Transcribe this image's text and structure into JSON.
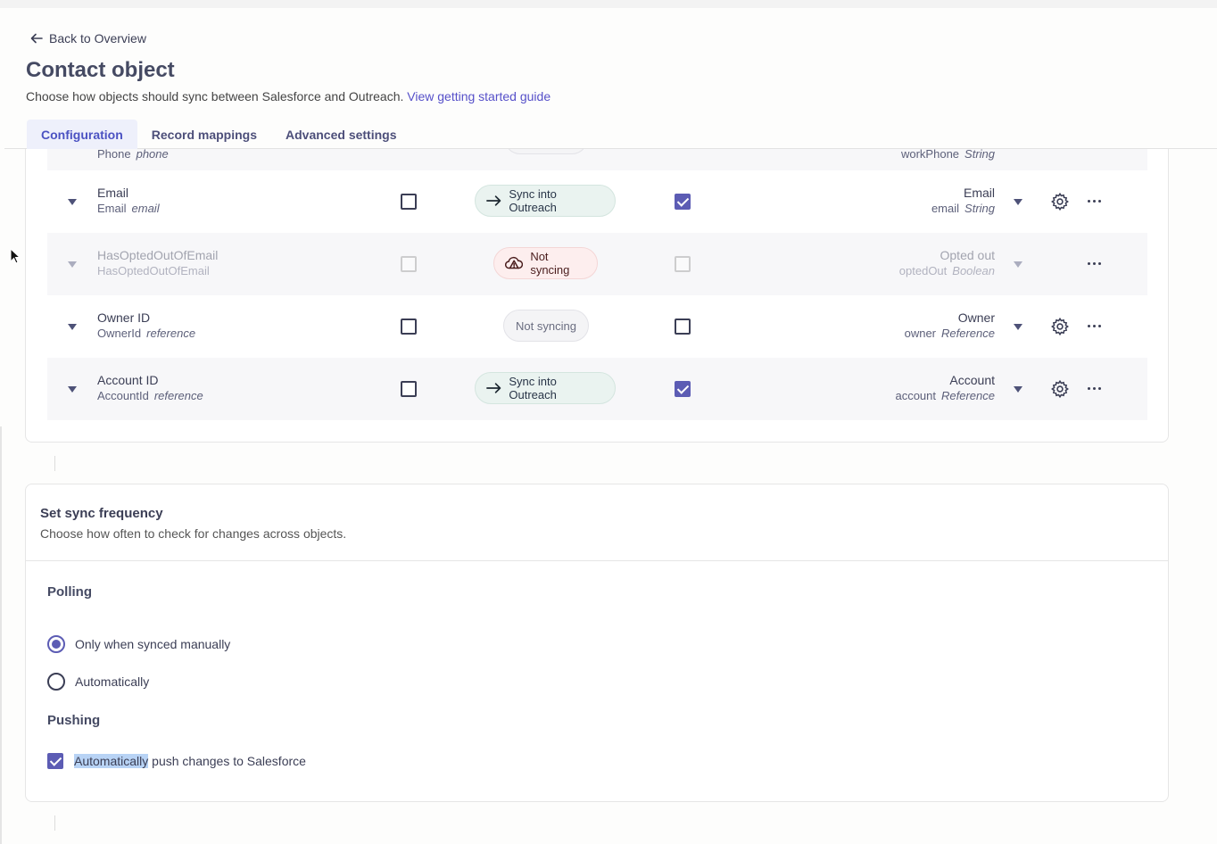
{
  "header": {
    "back_label": "Back to Overview",
    "title": "Contact object",
    "subtitle": "Choose how objects should sync between Salesforce and Outreach.",
    "guide_link": "View getting started guide",
    "tabs": [
      {
        "label": "Configuration",
        "active": true
      },
      {
        "label": "Record mappings",
        "active": false
      },
      {
        "label": "Advanced settings",
        "active": false
      }
    ]
  },
  "partial_row": {
    "name": "Phone",
    "api": "phone",
    "right_api": "workPhone",
    "right_type": "String"
  },
  "mappings": [
    {
      "name": "Email",
      "api_name": "Email",
      "api_type": "email",
      "left_checked": false,
      "sync_label": "Sync into Outreach",
      "sync_state": "sync",
      "right_checked": true,
      "right_name": "Email",
      "right_api": "email",
      "right_type": "String",
      "disabled": false,
      "has_gear": true
    },
    {
      "name": "HasOptedOutOfEmail",
      "api_name": "HasOptedOutOfEmail",
      "api_type": "",
      "left_checked": false,
      "sync_label": "Not syncing",
      "sync_state": "warn",
      "right_checked": false,
      "right_name": "Opted out",
      "right_api": "optedOut",
      "right_type": "Boolean",
      "disabled": true,
      "has_gear": false
    },
    {
      "name": "Owner ID",
      "api_name": "OwnerId",
      "api_type": "reference",
      "left_checked": false,
      "sync_label": "Not syncing",
      "sync_state": "notsync",
      "right_checked": false,
      "right_name": "Owner",
      "right_api": "owner",
      "right_type": "Reference",
      "disabled": false,
      "has_gear": true
    },
    {
      "name": "Account ID",
      "api_name": "AccountId",
      "api_type": "reference",
      "left_checked": false,
      "sync_label": "Sync into Outreach",
      "sync_state": "sync",
      "right_checked": true,
      "right_name": "Account",
      "right_api": "account",
      "right_type": "Reference",
      "disabled": false,
      "has_gear": true
    }
  ],
  "frequency": {
    "title": "Set sync frequency",
    "subtitle": "Choose how often to check for changes across objects.",
    "polling_label": "Polling",
    "options": [
      {
        "label": "Only when synced manually",
        "selected": true
      },
      {
        "label": "Automatically",
        "selected": false
      }
    ],
    "pushing_label": "Pushing",
    "push_highlight": "Automatically",
    "push_rest": " push changes to Salesforce",
    "push_checked": true
  },
  "colors": {
    "accent": "#5c5cb4",
    "link": "#5650c9",
    "sync_bg": "#eaf3f0",
    "warn_bg": "#fdeeee"
  }
}
